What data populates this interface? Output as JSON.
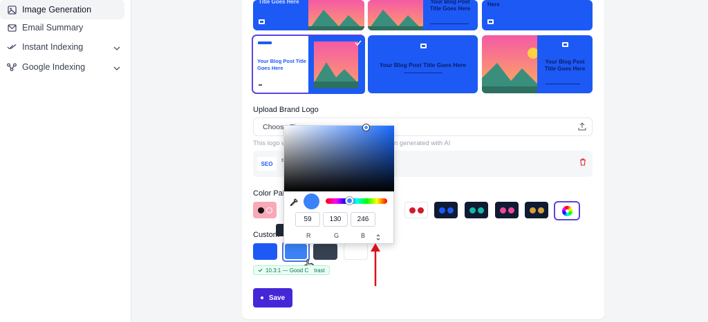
{
  "sidebar": {
    "items": [
      {
        "label": "Image Generation",
        "icon": "image-icon"
      },
      {
        "label": "Email Summary",
        "icon": "mail-icon"
      },
      {
        "label": "Instant Indexing",
        "icon": "double-check-icon"
      },
      {
        "label": "Google Indexing",
        "icon": "network-icon"
      }
    ]
  },
  "templates": {
    "title_text": "Your Blog Post Title Goes Here",
    "top_row_fragment_1": "Title Goes Here",
    "top_row_fragment_2": "Your Blog Post Title Goes Here",
    "top_row_fragment_3": "Here"
  },
  "upload": {
    "label": "Upload Brand Logo",
    "input_text": "Choose Fi",
    "hint_left": "This logo w",
    "hint_right": "n generated with AI",
    "logo_text": "SEO",
    "file_initial": "s"
  },
  "palette": {
    "label": "Color Pale",
    "swatches": [
      {
        "colors": [
          "#111111",
          "#f9a8b8"
        ],
        "bg": "#f9a8b8"
      },
      {
        "colors": [
          "#d11a2a",
          "#d11a2a"
        ],
        "bg": "#ffffff"
      },
      {
        "colors": [
          "#1d5af5",
          "#1d5af5"
        ],
        "bg": "#0f1a33"
      },
      {
        "colors": [
          "#14b8a6",
          "#14b8a6"
        ],
        "bg": "#0f1a33"
      },
      {
        "colors": [
          "#ec4899",
          "#ec4899"
        ],
        "bg": "#0f1a33"
      },
      {
        "colors": [
          "#d4a03a",
          "#d4a03a"
        ],
        "bg": "#0f1a33"
      }
    ]
  },
  "custom": {
    "label": "Custom",
    "colors": [
      "#1d5af5",
      "#3b82f6",
      "#374151",
      "#ffffff"
    ]
  },
  "picker": {
    "r": "59",
    "g": "130",
    "b": "246",
    "r_label": "R",
    "g_label": "G",
    "b_label": "B",
    "current_color": "#3b82f6"
  },
  "contrast_badge": {
    "text": "10.3:1 — Good C",
    "text2": "trast"
  },
  "save_label": "Save",
  "colors": {
    "accent": "#4527d8",
    "brand_blue": "#1d5af5",
    "arrow": "#d90f1c"
  }
}
